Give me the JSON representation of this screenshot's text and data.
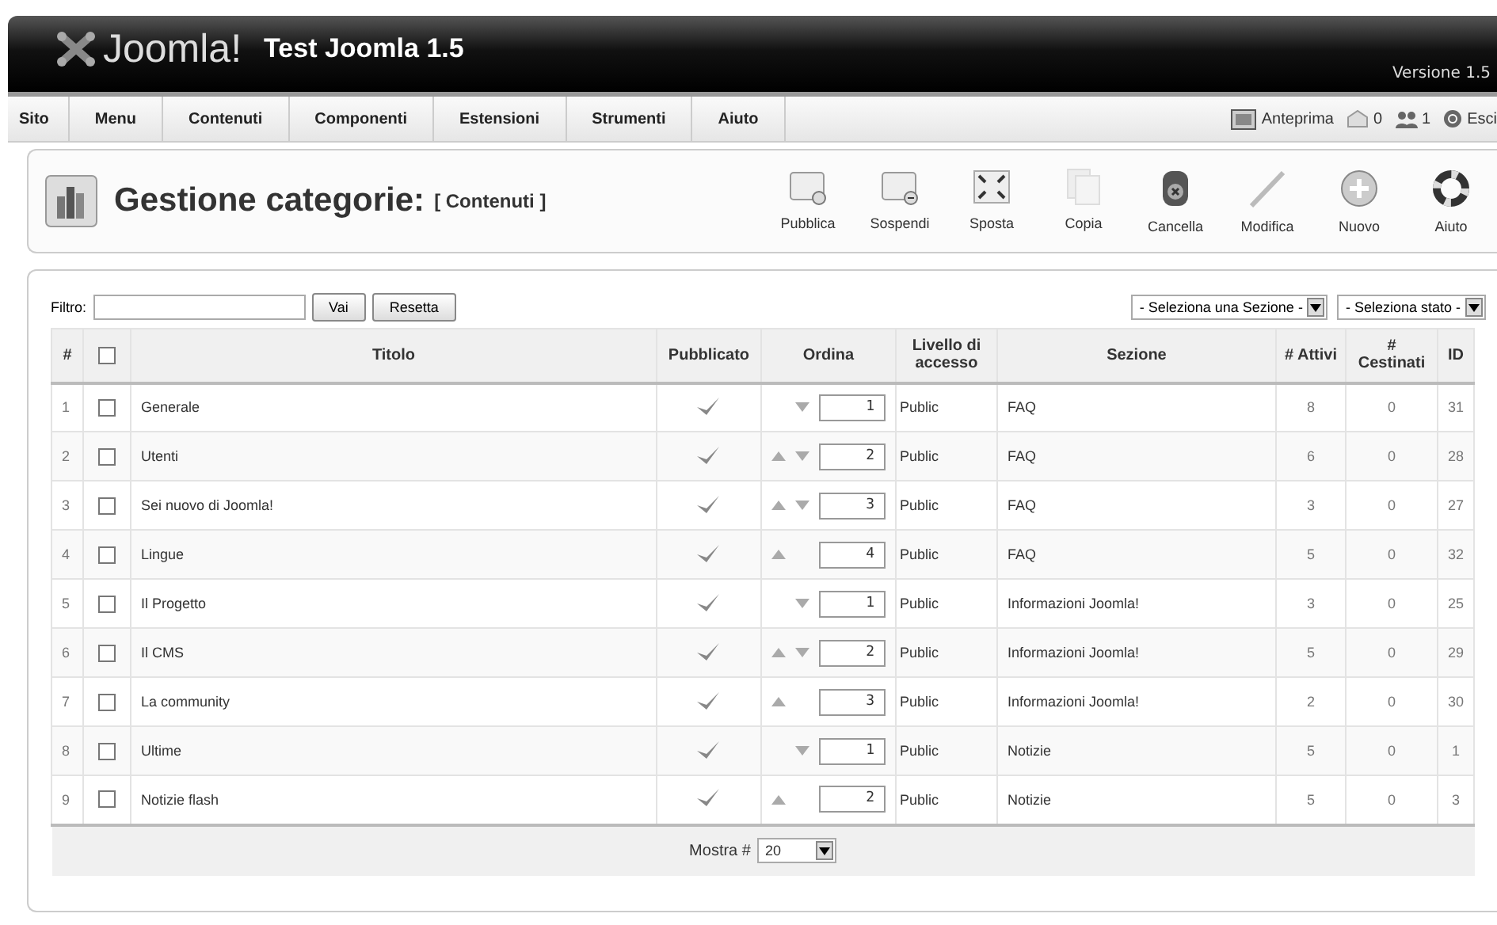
{
  "header": {
    "logo": "Joomla!",
    "site_title": "Test Joomla 1.5",
    "version": "Versione 1.5"
  },
  "menu": {
    "items": [
      {
        "label": "Sito"
      },
      {
        "label": "Menu"
      },
      {
        "label": "Contenuti"
      },
      {
        "label": "Componenti"
      },
      {
        "label": "Estensioni"
      },
      {
        "label": "Strumenti"
      },
      {
        "label": "Aiuto"
      }
    ],
    "status": [
      {
        "kind": "preview",
        "label": "Anteprima"
      },
      {
        "kind": "messages",
        "label": "0"
      },
      {
        "kind": "users",
        "label": "1"
      },
      {
        "kind": "logout",
        "label": "Esci"
      }
    ]
  },
  "toolbar": {
    "title": "Gestione categorie:",
    "subtitle": "[ Contenuti ]",
    "buttons": [
      {
        "kind": "publish",
        "label": "Pubblica"
      },
      {
        "kind": "unpublish",
        "label": "Sospendi"
      },
      {
        "kind": "move",
        "label": "Sposta"
      },
      {
        "kind": "copy",
        "label": "Copia"
      },
      {
        "kind": "delete",
        "label": "Cancella"
      },
      {
        "kind": "edit",
        "label": "Modifica"
      },
      {
        "kind": "new",
        "label": "Nuovo"
      },
      {
        "kind": "help",
        "label": "Aiuto"
      }
    ]
  },
  "filter": {
    "label": "Filtro:",
    "go": "Vai",
    "reset": "Resetta",
    "section_select": "- Seleziona una Sezione -",
    "state_select": "- Seleziona stato -"
  },
  "table": {
    "select_all": {
      "checked": false
    },
    "columns": [
      "#",
      "Titolo",
      "Pubblicato",
      "Ordina",
      "Livello di accesso",
      "Sezione",
      "# Attivi",
      "# Cestinati",
      "ID"
    ],
    "rows": [
      {
        "num": "1",
        "checked": false,
        "title": "Generale",
        "published": true,
        "move_up": false,
        "move_down": true,
        "order": "1",
        "access": "Public",
        "section": "FAQ",
        "active": "8",
        "trashed": "0",
        "id": "31"
      },
      {
        "num": "2",
        "checked": false,
        "title": "Utenti",
        "published": true,
        "move_up": true,
        "move_down": true,
        "order": "2",
        "access": "Public",
        "section": "FAQ",
        "active": "6",
        "trashed": "0",
        "id": "28"
      },
      {
        "num": "3",
        "checked": false,
        "title": "Sei nuovo di Joomla!",
        "published": true,
        "move_up": true,
        "move_down": true,
        "order": "3",
        "access": "Public",
        "section": "FAQ",
        "active": "3",
        "trashed": "0",
        "id": "27"
      },
      {
        "num": "4",
        "checked": false,
        "title": "Lingue",
        "published": true,
        "move_up": true,
        "move_down": false,
        "order": "4",
        "access": "Public",
        "section": "FAQ",
        "active": "5",
        "trashed": "0",
        "id": "32"
      },
      {
        "num": "5",
        "checked": false,
        "title": "Il Progetto",
        "published": true,
        "move_up": false,
        "move_down": true,
        "order": "1",
        "access": "Public",
        "section": "Informazioni Joomla!",
        "active": "3",
        "trashed": "0",
        "id": "25"
      },
      {
        "num": "6",
        "checked": false,
        "title": "Il CMS",
        "published": true,
        "move_up": true,
        "move_down": true,
        "order": "2",
        "access": "Public",
        "section": "Informazioni Joomla!",
        "active": "5",
        "trashed": "0",
        "id": "29"
      },
      {
        "num": "7",
        "checked": false,
        "title": "La community",
        "published": true,
        "move_up": true,
        "move_down": false,
        "order": "3",
        "access": "Public",
        "section": "Informazioni Joomla!",
        "active": "2",
        "trashed": "0",
        "id": "30"
      },
      {
        "num": "8",
        "checked": false,
        "title": "Ultime",
        "published": true,
        "move_up": false,
        "move_down": true,
        "order": "1",
        "access": "Public",
        "section": "Notizie",
        "active": "5",
        "trashed": "0",
        "id": "1"
      },
      {
        "num": "9",
        "checked": false,
        "title": "Notizie flash",
        "published": true,
        "move_up": true,
        "move_down": false,
        "order": "2",
        "access": "Public",
        "section": "Notizie",
        "active": "5",
        "trashed": "0",
        "id": "3"
      }
    ],
    "footer": {
      "label": "Mostra #",
      "limit": "20"
    }
  }
}
